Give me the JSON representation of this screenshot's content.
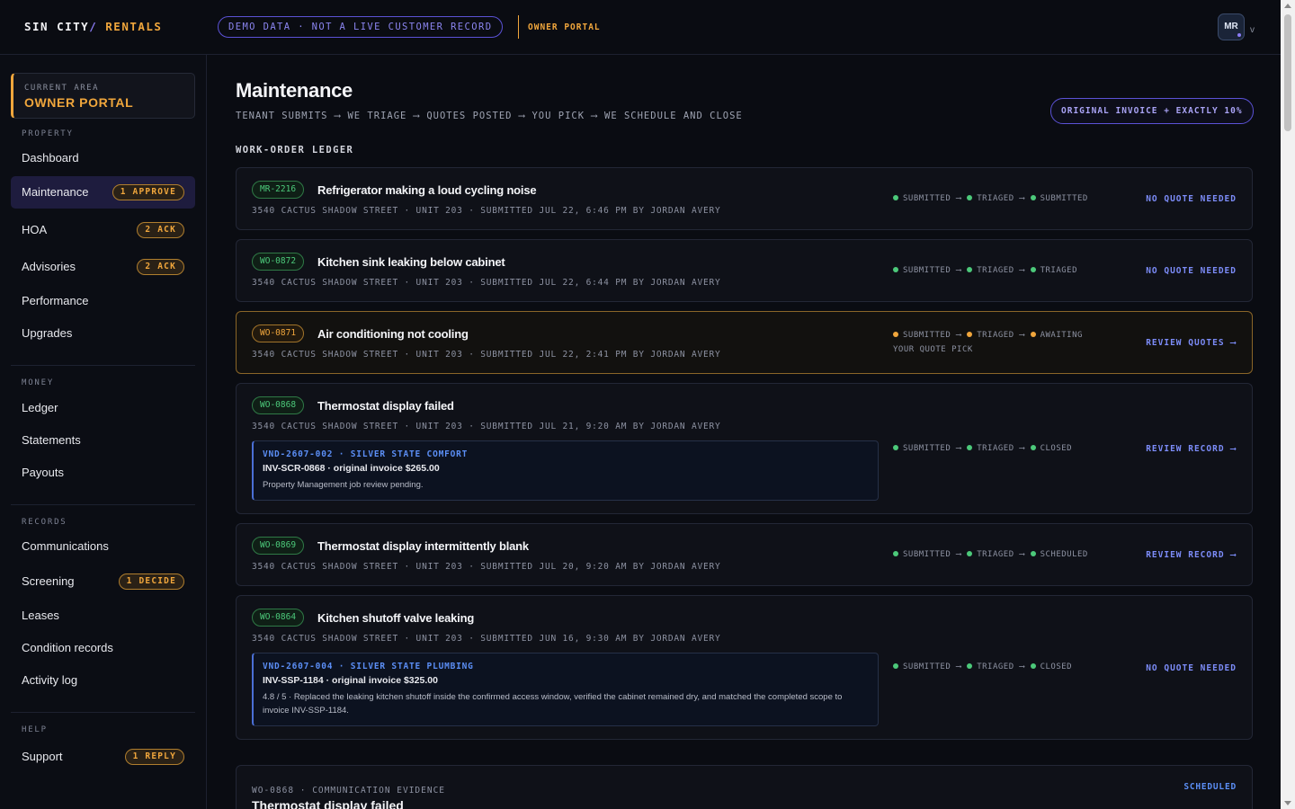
{
  "header": {
    "brand_main": "SIN CITY",
    "brand_slash": "/ ",
    "brand_accent": "RENTALS",
    "demo_notice": "DEMO DATA · NOT A LIVE CUSTOMER RECORD",
    "portal_tag": "OWNER PORTAL",
    "avatar_initials": "MR",
    "avatar_caret": "v"
  },
  "sidebar": {
    "current_area_label": "CURRENT AREA",
    "current_area_value": "OWNER PORTAL",
    "sections": {
      "property": "PROPERTY",
      "money": "MONEY",
      "records": "RECORDS",
      "help": "HELP"
    },
    "items": {
      "dashboard": {
        "label": "Dashboard"
      },
      "maintenance": {
        "label": "Maintenance",
        "badge": "1 APPROVE"
      },
      "hoa": {
        "label": "HOA",
        "badge": "2 ACK"
      },
      "advisories": {
        "label": "Advisories",
        "badge": "2 ACK"
      },
      "performance": {
        "label": "Performance"
      },
      "upgrades": {
        "label": "Upgrades"
      },
      "ledger": {
        "label": "Ledger"
      },
      "statements": {
        "label": "Statements"
      },
      "payouts": {
        "label": "Payouts"
      },
      "communications": {
        "label": "Communications"
      },
      "screening": {
        "label": "Screening",
        "badge": "1 DECIDE"
      },
      "leases": {
        "label": "Leases"
      },
      "condition_records": {
        "label": "Condition records"
      },
      "activity_log": {
        "label": "Activity log"
      },
      "support": {
        "label": "Support",
        "badge": "1 REPLY"
      }
    }
  },
  "main": {
    "title": "Maintenance",
    "flow": "TENANT SUBMITS ⟶ WE TRIAGE ⟶ QUOTES POSTED ⟶ YOU PICK ⟶ WE SCHEDULE AND CLOSE",
    "invoice_policy": "ORIGINAL INVOICE + EXACTLY 10%",
    "ledger_label": "WORK-ORDER LEDGER",
    "pipeline_arrow": "⟶",
    "work_orders": [
      {
        "id": "MR-2216",
        "title": "Refrigerator making a loud cycling noise",
        "meta": "3540 CACTUS SHADOW STREET · UNIT 203 · SUBMITTED JUL 22, 6:46 PM BY JORDAN AVERY",
        "step1": "SUBMITTED",
        "step2": "TRIAGED",
        "step3": "SUBMITTED",
        "action": "NO QUOTE NEEDED"
      },
      {
        "id": "WO-0872",
        "title": "Kitchen sink leaking below cabinet",
        "meta": "3540 CACTUS SHADOW STREET · UNIT 203 · SUBMITTED JUL 22, 6:44 PM BY JORDAN AVERY",
        "step1": "SUBMITTED",
        "step2": "TRIAGED",
        "step3": "TRIAGED",
        "action": "NO QUOTE NEEDED"
      },
      {
        "id": "WO-0871",
        "title": "Air conditioning not cooling",
        "meta": "3540 CACTUS SHADOW STREET · UNIT 203 · SUBMITTED JUL 22, 2:41 PM BY JORDAN AVERY",
        "step1": "SUBMITTED",
        "step2": "TRIAGED",
        "step3": "AWAITING",
        "step3_cont": "YOUR QUOTE PICK",
        "action": "REVIEW QUOTES ⟶"
      },
      {
        "id": "WO-0868",
        "title": "Thermostat display failed",
        "meta": "3540 CACTUS SHADOW STREET · UNIT 203 · SUBMITTED JUL 21, 9:20 AM BY JORDAN AVERY",
        "step1": "SUBMITTED",
        "step2": "TRIAGED",
        "step3": "CLOSED",
        "action": "REVIEW RECORD ⟶",
        "vendor": {
          "header": "VND-2607-002 · SILVER STATE COMFORT",
          "invoice": "INV-SCR-0868 · original invoice $265.00",
          "note": "Property Management job review pending."
        }
      },
      {
        "id": "WO-0869",
        "title": "Thermostat display intermittently blank",
        "meta": "3540 CACTUS SHADOW STREET · UNIT 203 · SUBMITTED JUL 20, 9:20 AM BY JORDAN AVERY",
        "step1": "SUBMITTED",
        "step2": "TRIAGED",
        "step3": "SCHEDULED",
        "action": "REVIEW RECORD ⟶"
      },
      {
        "id": "WO-0864",
        "title": "Kitchen shutoff valve leaking",
        "meta": "3540 CACTUS SHADOW STREET · UNIT 203 · SUBMITTED JUN 16, 9:30 AM BY JORDAN AVERY",
        "step1": "SUBMITTED",
        "step2": "TRIAGED",
        "step3": "CLOSED",
        "action": "NO QUOTE NEEDED",
        "vendor": {
          "header": "VND-2607-004 · SILVER STATE PLUMBING",
          "invoice": "INV-SSP-1184 · original invoice $325.00",
          "note": "4.8 / 5 · Replaced the leaking kitchen shutoff inside the confirmed access window, verified the cabinet remained dry, and matched the completed scope to invoice INV-SSP-1184."
        }
      }
    ],
    "evidence": {
      "header": "WO-0868 · COMMUNICATION EVIDENCE",
      "title": "Thermostat display failed",
      "status": "SCHEDULED"
    }
  },
  "colors": {
    "accent_amber": "#f0a63c",
    "accent_violet": "#8b7cf6",
    "status_green": "#4cc97a",
    "link_blue": "#7c8cf8",
    "background": "#0a0c12"
  }
}
